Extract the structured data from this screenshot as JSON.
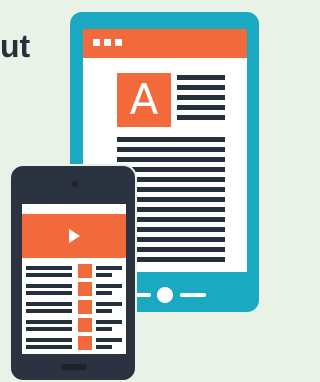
{
  "heading": {
    "fragment": "ut"
  },
  "tablet": {
    "logo_letter": "A"
  },
  "colors": {
    "background": "#e9f2e6",
    "tablet_frame": "#1aa9c0",
    "accent_orange": "#f26a3b",
    "dark_text": "#26303c",
    "phone_frame": "#2b3340"
  },
  "icons": [
    "three-dots-icon",
    "play-icon",
    "home-button-icon"
  ]
}
